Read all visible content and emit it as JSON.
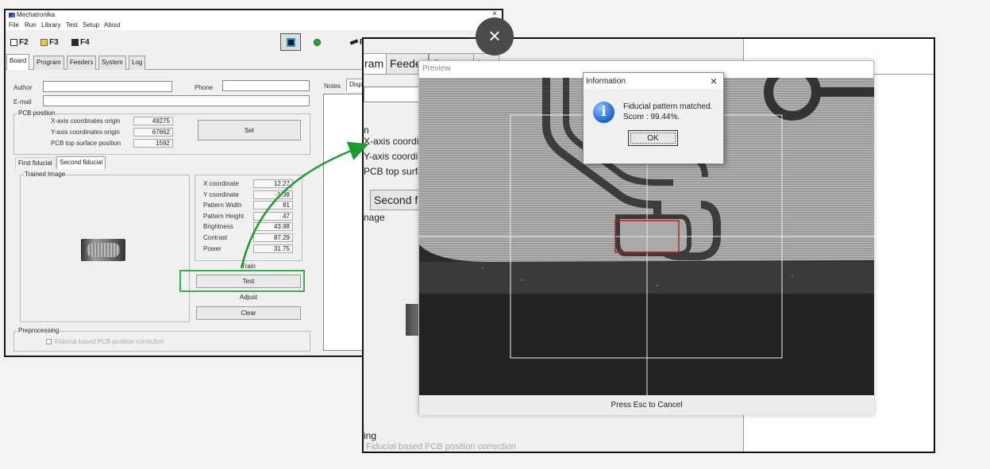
{
  "main_window": {
    "title": "Mechatronika",
    "close": "×",
    "menu": [
      "File",
      "Run",
      "Library",
      "Test",
      "Setup",
      "About"
    ],
    "toolbar": {
      "f2": "F2",
      "f3": "F3",
      "f4": "F4",
      "cut": "F"
    },
    "tabs": [
      "Board",
      "Program",
      "Feeders",
      "System",
      "Log"
    ],
    "author_label": "Author",
    "phone_label": "Phone",
    "email_label": "E-mail",
    "notes_label": "Notes",
    "disp_tab": "Disp",
    "pcb_position": {
      "title": "PCB position",
      "rows": [
        {
          "label": "X-axis coordinates origin",
          "value": "49275"
        },
        {
          "label": "Y-axis coordinates origin",
          "value": "67662"
        },
        {
          "label": "PCB top surface position",
          "value": "1592"
        }
      ],
      "set_button": "Set"
    },
    "fiducial_tabs": [
      "First fiducial",
      "Second fiducial"
    ],
    "trained_image_label": "Trained Image",
    "params": [
      {
        "label": "X coordinate",
        "value": "12.27"
      },
      {
        "label": "Y coordinate",
        "value": "-1.38"
      },
      {
        "label": "Pattern Width",
        "value": "81"
      },
      {
        "label": "Pattern Height",
        "value": "47"
      },
      {
        "label": "Brightness",
        "value": "43.98"
      },
      {
        "label": "Contrast",
        "value": "87.29"
      },
      {
        "label": "Power",
        "value": "31.75"
      }
    ],
    "buttons": {
      "train": "Train",
      "test": "Test",
      "adjust": "Adjust",
      "clear": "Clear"
    },
    "preprocessing": {
      "title": "Preprocessing",
      "checkbox_label": "Fiducial based PCB position correction"
    }
  },
  "zoom_window": {
    "tabs": [
      "ram",
      "Feeder",
      "System",
      "Log"
    ],
    "labels": [
      "n",
      "X-axis coordin",
      "Y-axis coordin",
      "PCB top surfa"
    ],
    "second_fiducial_tab": "Second fidu",
    "image_label": "nage",
    "preprocessing_fragment": "ing",
    "checkbox_fragment": "Fiducial based PCB position correction"
  },
  "preview": {
    "title": "Preview",
    "footer": "Press Esc to Cancel"
  },
  "info_dialog": {
    "title": "Information",
    "close": "×",
    "icon": "i",
    "line1": "Fiducial pattern matched.",
    "line2": "Score : 99.44%.",
    "ok": "OK"
  },
  "overlay": {
    "close_glyph": "×",
    "highlight_color": "#2db34a",
    "arrow_color": "#1f9a2e",
    "match_box_color": "#c81e1e"
  }
}
